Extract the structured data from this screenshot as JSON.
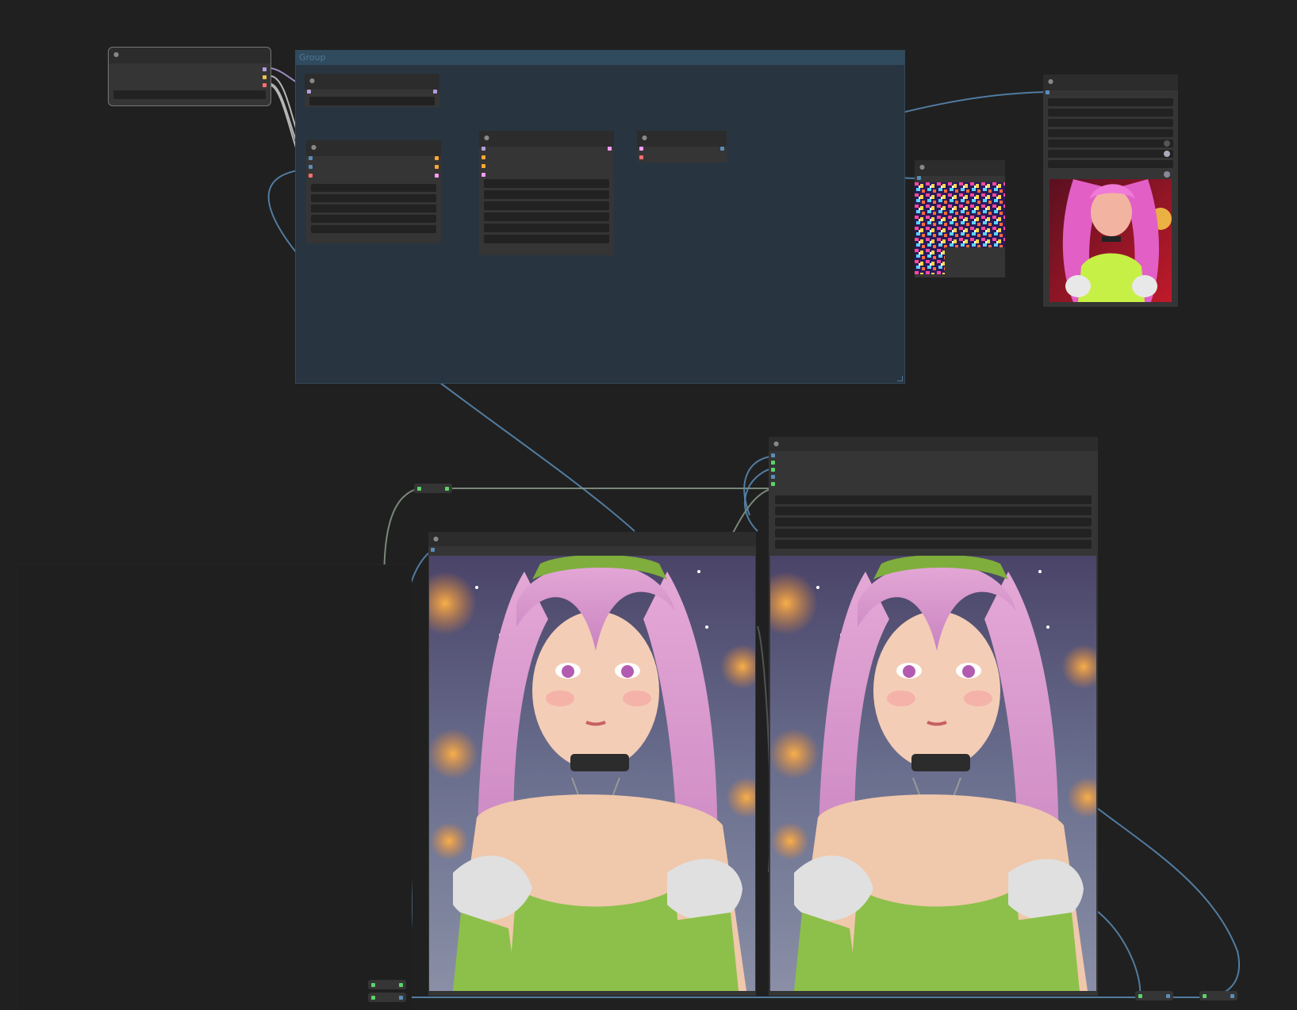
{
  "canvas": {
    "group": {
      "title": "Group"
    },
    "colors": {
      "background": "#202020",
      "group_fill": "#283540",
      "group_header": "#304a5e",
      "node_body": "#353535",
      "node_header": "#2c2c2c",
      "link_image": "#5b8db8",
      "link_model": "#b39ddb",
      "link_clip": "#f0c14b",
      "link_conditioning": "#ffa931",
      "link_latent": "#ff9cf9",
      "link_vae": "#ff6e6e",
      "link_generic": "#8a9a8a"
    },
    "nodes": [
      {
        "id": "checkpoint-loader",
        "icon": "collapse-dot-icon"
      },
      {
        "id": "lora-loader",
        "icon": "collapse-dot-icon"
      },
      {
        "id": "text-encoder",
        "icon": "collapse-dot-icon"
      },
      {
        "id": "ksampler",
        "icon": "collapse-dot-icon"
      },
      {
        "id": "vae-decode",
        "icon": "collapse-dot-icon"
      },
      {
        "id": "preview-grid",
        "icon": "collapse-dot-icon"
      },
      {
        "id": "preview-right",
        "icon": "collapse-dot-icon"
      },
      {
        "id": "upscale-node",
        "icon": "collapse-dot-icon"
      },
      {
        "id": "image-preview-left",
        "icon": "collapse-dot-icon"
      }
    ]
  }
}
